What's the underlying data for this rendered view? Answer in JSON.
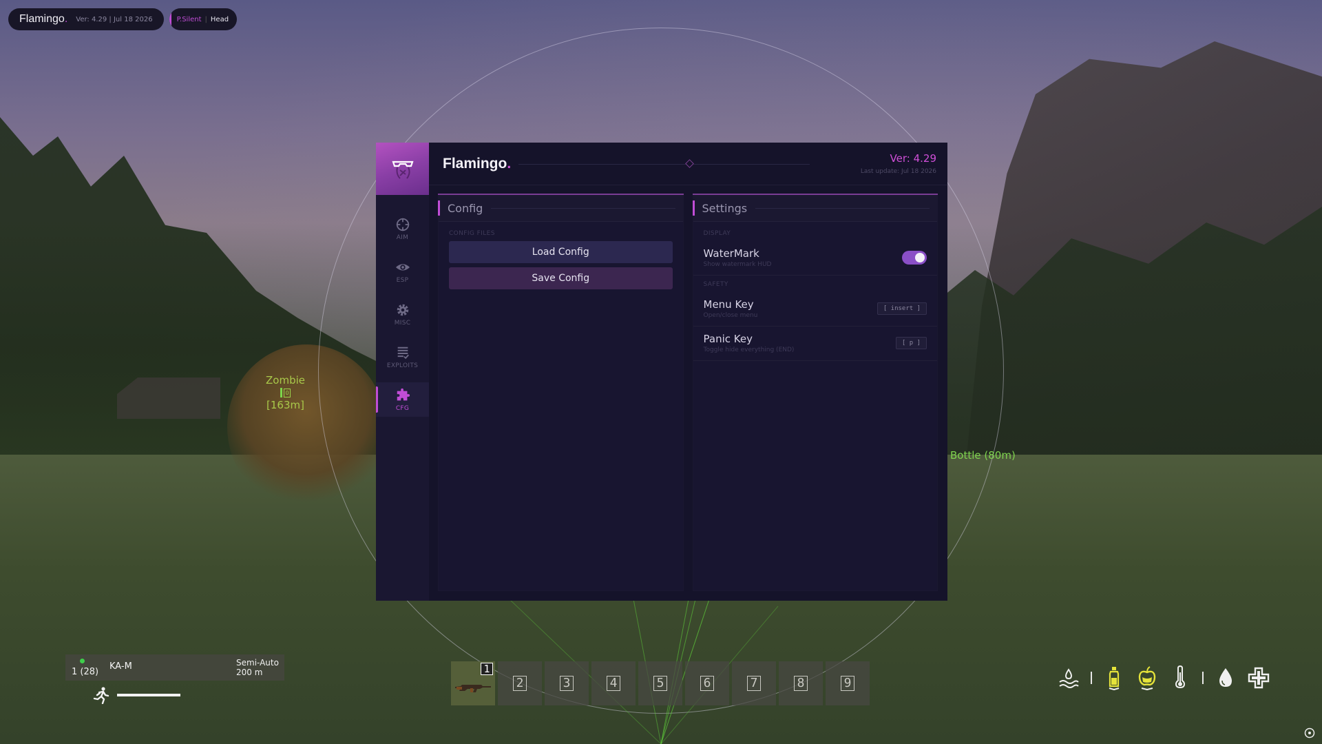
{
  "watermark": {
    "brand": "Flamingo",
    "brand_dot": ".",
    "meta": "Ver: 4.29  |  Jul 18 2026",
    "aim_mode": "P.Silent",
    "separator": "|",
    "target": "Head"
  },
  "menu": {
    "brand": "Flamingo",
    "brand_dot": ".",
    "version": "Ver: 4.29",
    "last_update": "Last update: Jul 18 2026",
    "nav": [
      {
        "label": "AIM",
        "icon": "crosshair-icon"
      },
      {
        "label": "ESP",
        "icon": "eye-icon"
      },
      {
        "label": "MISC",
        "icon": "gear-icon"
      },
      {
        "label": "EXPLOITS",
        "icon": "list-check-icon"
      },
      {
        "label": "CFG",
        "icon": "puzzle-icon",
        "active": true
      }
    ],
    "config_panel": {
      "title": "Config",
      "group_label": "CONFIG FILES",
      "load_label": "Load Config",
      "save_label": "Save Config"
    },
    "settings_panel": {
      "title": "Settings",
      "display_label": "DISPLAY",
      "watermark_name": "WaterMark",
      "watermark_desc": "Show watermark HUD",
      "watermark_enabled": true,
      "safety_label": "SAFETY",
      "menu_key_name": "Menu Key",
      "menu_key_desc": "Open/close menu",
      "menu_key_value": "[ insert ]",
      "panic_key_name": "Panic Key",
      "panic_key_desc": "Toggle hide everything (END)",
      "panic_key_value": "[ p ]"
    }
  },
  "esp": {
    "zombie_name": "Zombie",
    "zombie_distance": "[163m]",
    "zombie_box_char": "0",
    "bottle_label": "Bottle (80m)"
  },
  "weapon": {
    "ammo": "1 (28)",
    "name": "KA-M",
    "fire_mode": "Semi-Auto",
    "zeroing": "200 m"
  },
  "hotbar": {
    "slots": [
      "1",
      "2",
      "3",
      "4",
      "5",
      "6",
      "7",
      "8",
      "9"
    ],
    "active_slot": 1
  },
  "colors": {
    "accent": "#c04dd6",
    "panel_bg": "#15132a",
    "toggle_on": "#8a4fc7",
    "esp_item": "#7fd34f"
  }
}
